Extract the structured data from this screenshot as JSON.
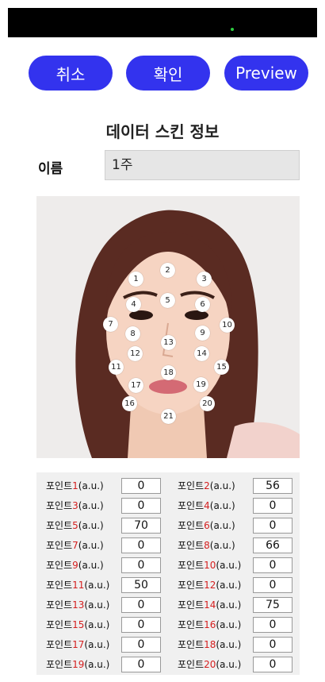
{
  "buttons": {
    "cancel": "취소",
    "confirm": "확인",
    "preview": "Preview"
  },
  "title": "데이터 스킨 정보",
  "name": {
    "label": "이름",
    "value": "1주"
  },
  "points": [
    {
      "label": "포인트",
      "num": "1",
      "unit": "(a.u.)",
      "value": "0"
    },
    {
      "label": "포인트",
      "num": "2",
      "unit": "(a.u.)",
      "value": "56"
    },
    {
      "label": "포인트",
      "num": "3",
      "unit": "(a.u.)",
      "value": "0"
    },
    {
      "label": "포인트",
      "num": "4",
      "unit": "(a.u.)",
      "value": "0"
    },
    {
      "label": "포인트",
      "num": "5",
      "unit": "(a.u.)",
      "value": "70"
    },
    {
      "label": "포인트",
      "num": "6",
      "unit": "(a.u.)",
      "value": "0"
    },
    {
      "label": "포인트",
      "num": "7",
      "unit": "(a.u.)",
      "value": "0"
    },
    {
      "label": "포인트",
      "num": "8",
      "unit": "(a.u.)",
      "value": "66"
    },
    {
      "label": "포인트",
      "num": "9",
      "unit": "(a.u.)",
      "value": "0"
    },
    {
      "label": "포인트",
      "num": "10",
      "unit": "(a.u.)",
      "value": "0"
    },
    {
      "label": "포인트",
      "num": "11",
      "unit": "(a.u.)",
      "value": "50"
    },
    {
      "label": "포인트",
      "num": "12",
      "unit": "(a.u.)",
      "value": "0"
    },
    {
      "label": "포인트",
      "num": "13",
      "unit": "(a.u.)",
      "value": "0"
    },
    {
      "label": "포인트",
      "num": "14",
      "unit": "(a.u.)",
      "value": "75"
    },
    {
      "label": "포인트",
      "num": "15",
      "unit": "(a.u.)",
      "value": "0"
    },
    {
      "label": "포인트",
      "num": "16",
      "unit": "(a.u.)",
      "value": "0"
    },
    {
      "label": "포인트",
      "num": "17",
      "unit": "(a.u.)",
      "value": "0"
    },
    {
      "label": "포인트",
      "num": "18",
      "unit": "(a.u.)",
      "value": "0"
    },
    {
      "label": "포인트",
      "num": "19",
      "unit": "(a.u.)",
      "value": "0"
    },
    {
      "label": "포인트",
      "num": "20",
      "unit": "(a.u.)",
      "value": "0"
    }
  ],
  "face_markers": [
    "1",
    "2",
    "3",
    "4",
    "5",
    "6",
    "7",
    "8",
    "9",
    "10",
    "11",
    "12",
    "13",
    "14",
    "15",
    "16",
    "17",
    "18",
    "19",
    "20",
    "21"
  ],
  "colors": {
    "button": "#3333ee",
    "point_number": "#d42020"
  }
}
